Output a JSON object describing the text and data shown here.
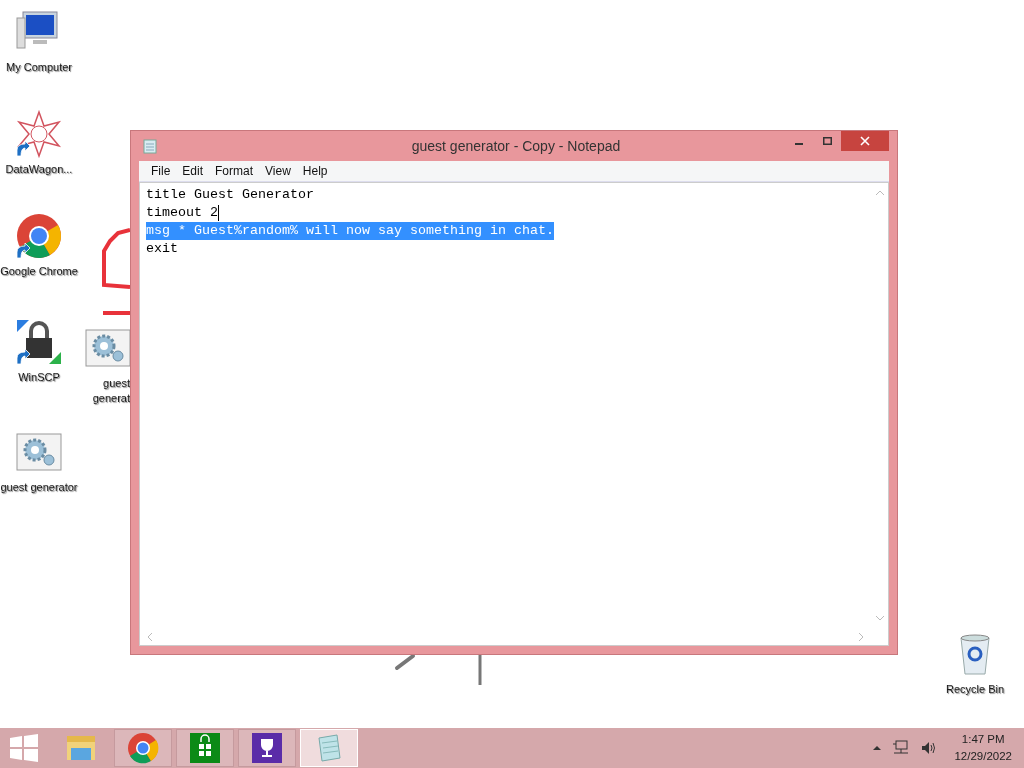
{
  "desktop_icons": [
    {
      "label": "My Computer",
      "kind": "computer",
      "shortcut": false
    },
    {
      "label": "DataWagon...",
      "kind": "star",
      "shortcut": true
    },
    {
      "label": "Google Chrome",
      "kind": "chrome",
      "shortcut": true
    },
    {
      "label": "WinSCP",
      "kind": "lock",
      "shortcut": true
    },
    {
      "label": "guest generat",
      "kind": "script",
      "shortcut": false
    },
    {
      "label": "guest generator",
      "kind": "script",
      "shortcut": false
    },
    {
      "label": "Recycle Bin",
      "kind": "bin",
      "shortcut": false
    }
  ],
  "window": {
    "title": "guest generator - Copy - Notepad",
    "menu": [
      "File",
      "Edit",
      "Format",
      "View",
      "Help"
    ],
    "lines": [
      {
        "text": "title Guest Generator",
        "selected": false,
        "caret": false
      },
      {
        "text": "timeout 2",
        "selected": false,
        "caret": true
      },
      {
        "text": "msg * Guest%random% will now say something in chat.",
        "selected": true,
        "caret": false
      },
      {
        "text": "exit",
        "selected": false,
        "caret": false
      }
    ]
  },
  "taskbar": {
    "items": [
      {
        "kind": "explorer",
        "active": false
      },
      {
        "kind": "chrome",
        "active": false
      },
      {
        "kind": "store",
        "active": false
      },
      {
        "kind": "trophy",
        "active": false
      },
      {
        "kind": "notepad",
        "active": true
      }
    ],
    "time": "1:47 PM",
    "date": "12/29/2022"
  }
}
